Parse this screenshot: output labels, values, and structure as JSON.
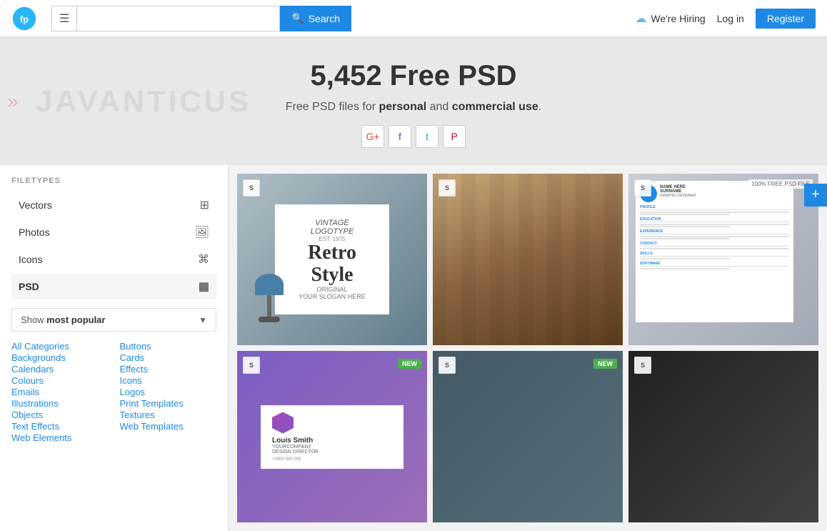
{
  "header": {
    "logo_text": "freepik",
    "hamburger_label": "☰",
    "search_placeholder": "",
    "search_btn_label": "Search",
    "search_icon": "🔍",
    "we_hiring_label": "We're Hiring",
    "login_label": "Log in",
    "register_label": "Register"
  },
  "hero": {
    "title": "5,452 Free PSD",
    "subtitle_before": "Free PSD files for ",
    "subtitle_personal": "personal",
    "subtitle_middle": " and ",
    "subtitle_commercial": "commercial use",
    "subtitle_after": ".",
    "watermark": "JAVANTICUS",
    "social": {
      "gplus": "G+",
      "facebook": "f",
      "twitter": "t",
      "pinterest": "P"
    }
  },
  "sidebar": {
    "filetypes_label": "FILETYPES",
    "items": [
      {
        "name": "Vectors",
        "icon": "⊞"
      },
      {
        "name": "Photos",
        "icon": "🖼"
      },
      {
        "name": "Icons",
        "icon": "⌘"
      },
      {
        "name": "PSD",
        "icon": "▦",
        "active": true
      }
    ],
    "show_popular": {
      "prefix": "Show ",
      "highlight": "most popular"
    },
    "categories_left": [
      "All Categories",
      "Backgrounds",
      "Calendars",
      "Colours",
      "Emails",
      "Illustrations",
      "Objects",
      "Text Effects",
      "Web Elements"
    ],
    "categories_right": [
      "Buttons",
      "Cards",
      "Effects",
      "Icons",
      "Logos",
      "Print Templates",
      "Textures",
      "Web Templates"
    ]
  },
  "content": {
    "cards": [
      {
        "id": 1,
        "badge": "S",
        "type": "retro-poster",
        "new": false
      },
      {
        "id": 2,
        "badge": "S",
        "type": "wood-texture",
        "new": false
      },
      {
        "id": 3,
        "badge": "S",
        "type": "cv-resume",
        "new": false
      },
      {
        "id": 4,
        "badge": "S",
        "type": "business-card",
        "new": true
      },
      {
        "id": 5,
        "badge": "S",
        "type": "dark-texture",
        "new": true
      },
      {
        "id": 6,
        "badge": "S",
        "type": "dark-photo",
        "new": false
      }
    ]
  },
  "fab": {
    "label": "+"
  }
}
